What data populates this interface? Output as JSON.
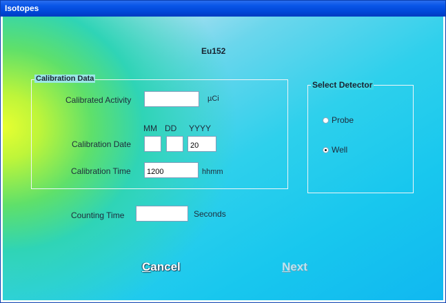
{
  "window": {
    "title": "Isotopes"
  },
  "isotope": "Eu152",
  "calibration": {
    "group_label": "Calibration Data",
    "activity_label": "Calibrated Activity",
    "activity_value": "",
    "activity_unit": "µCi",
    "date_label": "Calibration Date",
    "date_headers": {
      "mm": "MM",
      "dd": "DD",
      "yyyy": "YYYY"
    },
    "date_mm": "",
    "date_dd": "",
    "date_yyyy": "20",
    "time_label": "Calibration Time",
    "time_value": "1200",
    "time_unit": "hhmm"
  },
  "counting": {
    "label": "Counting Time",
    "value": "",
    "unit": "Seconds"
  },
  "detector": {
    "group_label": "Select Detector",
    "options": [
      {
        "label": "Probe",
        "selected": false
      },
      {
        "label": "Well",
        "selected": true
      }
    ]
  },
  "buttons": {
    "cancel": {
      "first": "C",
      "rest": "ancel"
    },
    "next": {
      "first": "N",
      "rest": "ext",
      "enabled": false
    }
  }
}
